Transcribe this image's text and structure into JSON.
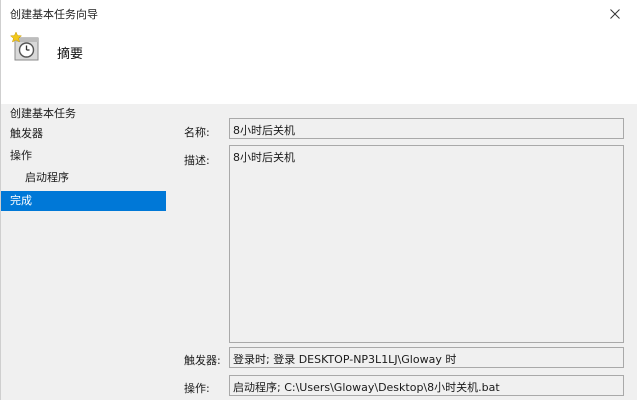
{
  "window": {
    "title": "创建基本任务向导"
  },
  "header": {
    "title": "摘要",
    "icon": "task-clock-icon"
  },
  "nav": {
    "items": [
      {
        "label": "创建基本任务",
        "selected": false
      },
      {
        "label": "触发器",
        "selected": false
      },
      {
        "label": "操作",
        "selected": false
      },
      {
        "label": "启动程序",
        "selected": false
      },
      {
        "label": "完成",
        "selected": true
      }
    ]
  },
  "summary": {
    "name_label": "名称:",
    "name_value": "8小时后关机",
    "description_label": "描述:",
    "description_value": "8小时后关机",
    "trigger_label": "触发器:",
    "trigger_value": "登录时; 登录 DESKTOP-NP3L1LJ\\Gloway 时",
    "action_label": "操作:",
    "action_value": "启动程序; C:\\Users\\Gloway\\Desktop\\8小时关机.bat"
  },
  "colors": {
    "selected_bg": "#0078d7",
    "panel_bg": "#f0f0f0",
    "border": "#a9a9a9"
  }
}
